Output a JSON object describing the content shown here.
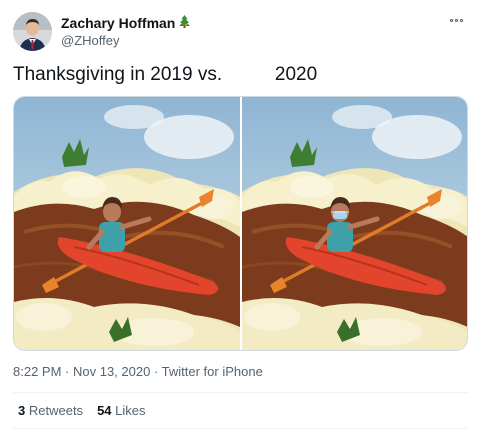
{
  "tweet": {
    "author": {
      "display_name": "Zachary Hoffman",
      "emoji": "🎄",
      "handle": "@ZHoffey"
    },
    "text_part1": "Thanksgiving in 2019 vs.",
    "text_part2": "2020",
    "images": [
      {
        "description": "Woman kayaking on gravy river through mashed potatoes"
      },
      {
        "description": "Same woman kayaking on gravy river wearing a face mask"
      }
    ],
    "time": "8:22 PM",
    "date": "Nov 13, 2020",
    "source": "Twitter for iPhone",
    "retweets_count": "3",
    "retweets_label": "Retweets",
    "likes_count": "54",
    "likes_label": "Likes"
  },
  "icons": {
    "more": "more-icon",
    "tree_emoji": "christmas-tree-emoji"
  }
}
